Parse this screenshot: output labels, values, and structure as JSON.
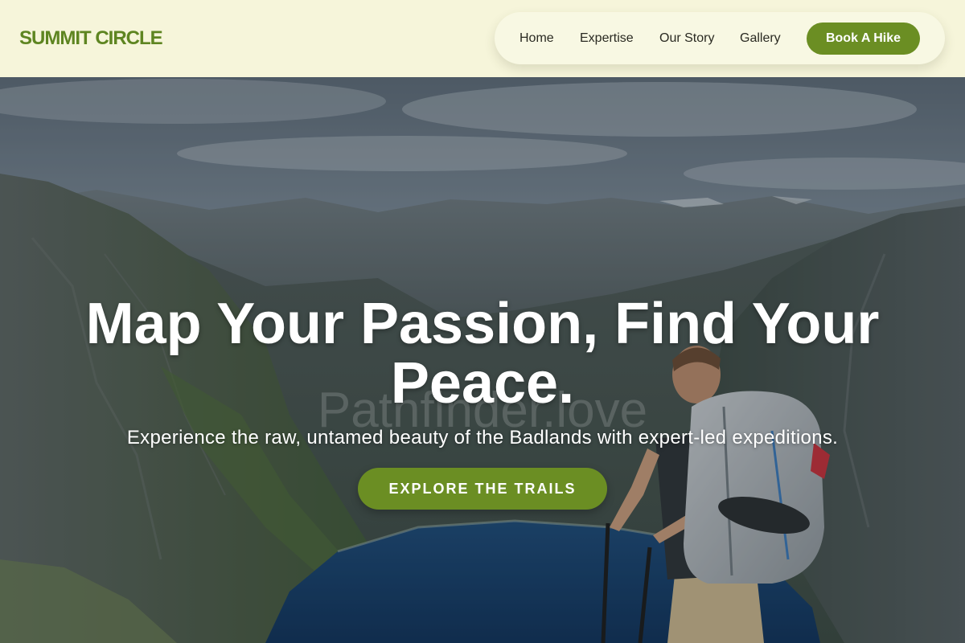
{
  "header": {
    "logo": "SUMMIT CIRCLE",
    "nav": [
      {
        "label": "Home"
      },
      {
        "label": "Expertise"
      },
      {
        "label": "Our Story"
      },
      {
        "label": "Gallery"
      }
    ],
    "cta_label": "Book A Hike"
  },
  "hero": {
    "image_alt": "Hiker with backpack and trekking poles overlooking a mountain lake in a deep valley",
    "watermark": "Pathfinder.love",
    "title": "Map Your Passion, Find Your Peace.",
    "subtitle": "Experience the raw, untamed beauty of the Badlands with expert-led expeditions.",
    "cta_label": "EXPLORE THE TRAILS"
  },
  "colors": {
    "header_bg": "#f6f5da",
    "brand_green": "#6b8e23",
    "logo_green": "#5e8521",
    "nav_text": "#2a2a22",
    "hero_text": "#ffffff"
  }
}
